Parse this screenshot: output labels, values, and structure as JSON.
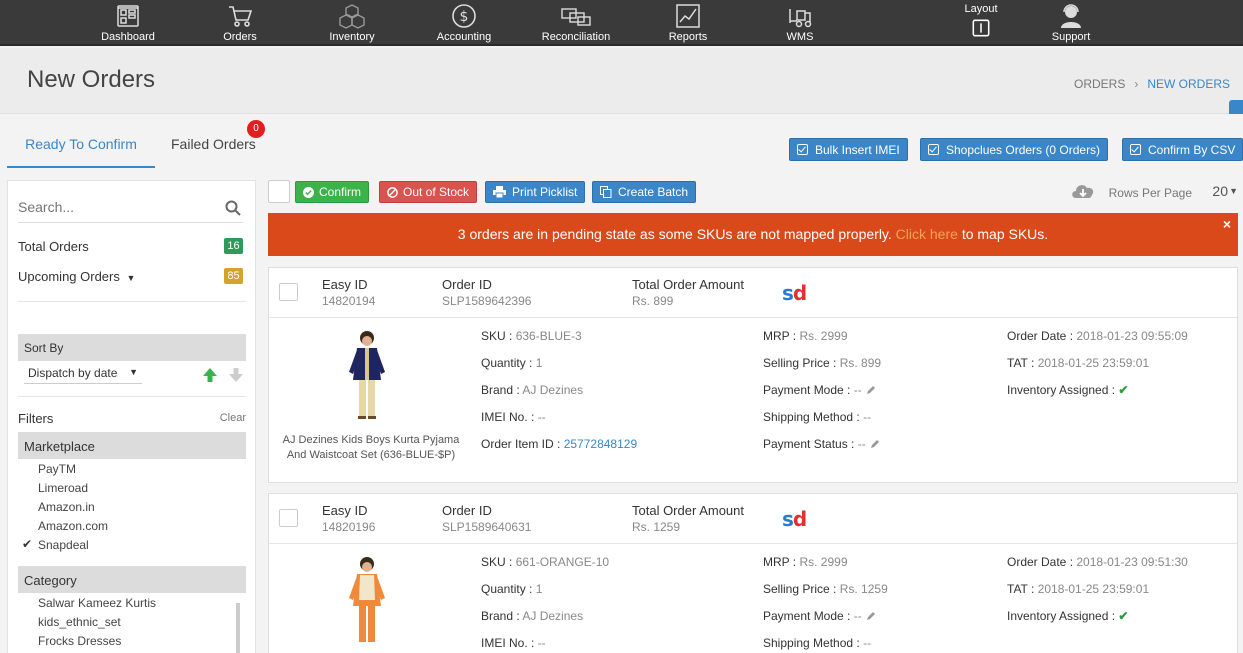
{
  "nav": {
    "items": [
      {
        "label": "Dashboard",
        "icon": "dashboard-icon"
      },
      {
        "label": "Orders",
        "icon": "cart-icon"
      },
      {
        "label": "Inventory",
        "icon": "cubes-icon"
      },
      {
        "label": "Accounting",
        "icon": "dollar-icon"
      },
      {
        "label": "Reconciliation",
        "icon": "reconciliation-icon"
      },
      {
        "label": "Reports",
        "icon": "chart-icon"
      },
      {
        "label": "WMS",
        "icon": "forklift-icon"
      },
      {
        "label": "Layout",
        "icon": "layout-icon"
      },
      {
        "label": "Support",
        "icon": "support-agent-icon"
      }
    ]
  },
  "header": {
    "title": "New Orders",
    "breadcrumb": [
      "ORDERS",
      "NEW ORDERS"
    ],
    "breadcrumb_sep": "›"
  },
  "tabs": {
    "ready": "Ready To Confirm",
    "failed": "Failed Orders",
    "failed_count": "0"
  },
  "toolbar": {
    "bulk_imei": "Bulk Insert IMEI",
    "shopclues": "Shopclues Orders (0 Orders)",
    "confirm_csv": "Confirm By CSV"
  },
  "sidebar": {
    "search_placeholder": "Search...",
    "total_orders_label": "Total Orders",
    "total_orders_count": "16",
    "upcoming_orders_label": "Upcoming Orders",
    "upcoming_orders_count": "85",
    "sort_by": "Sort By",
    "sort_value": "Dispatch by date",
    "filters": "Filters",
    "clear": "Clear",
    "marketplace": "Marketplace",
    "marketplace_items": [
      {
        "label": "PayTM",
        "checked": false
      },
      {
        "label": "Limeroad",
        "checked": false
      },
      {
        "label": "Amazon.in",
        "checked": false
      },
      {
        "label": "Amazon.com",
        "checked": false
      },
      {
        "label": "Snapdeal",
        "checked": true
      }
    ],
    "category": "Category",
    "category_items": [
      "Salwar Kameez Kurtis",
      "kids_ethnic_set",
      "Frocks Dresses"
    ]
  },
  "actions": {
    "confirm": "Confirm",
    "out_of_stock": "Out of Stock",
    "print_picklist": "Print Picklist",
    "create_batch": "Create Batch",
    "rows_per_page_label": "Rows Per Page",
    "rows_per_page_value": "20"
  },
  "alert": {
    "before": "3 orders are in pending state as some SKUs are not mapped properly.",
    "link": "Click here",
    "after": "to map SKUs.",
    "close": "×"
  },
  "labels": {
    "easy_id": "Easy ID",
    "order_id": "Order ID",
    "total_amount": "Total Order Amount",
    "sku": "SKU :",
    "quantity": "Quantity :",
    "brand": "Brand :",
    "imei": "IMEI No. :",
    "order_item_id": "Order Item ID :",
    "mrp": "MRP :",
    "selling_price": "Selling Price :",
    "payment_mode": "Payment Mode :",
    "shipping_method": "Shipping Method :",
    "payment_status": "Payment Status :",
    "order_date": "Order Date :",
    "tat": "TAT :",
    "inventory_assigned": "Inventory Assigned :"
  },
  "orders": [
    {
      "easy_id": "14820194",
      "order_id": "SLP1589642396",
      "total": "Rs. 899",
      "marketplace_logo": "sd",
      "product_name": "AJ Dezines Kids Boys Kurta Pyjama And Waistcoat Set (636-BLUE-$P)",
      "sku": "636-BLUE-3",
      "quantity": "1",
      "brand": "AJ Dezines",
      "imei": "--",
      "order_item_id": "25772848129",
      "mrp": "Rs. 2999",
      "selling_price": "Rs. 899",
      "payment_mode": "--",
      "shipping_method": "--",
      "payment_status": "--",
      "order_date": "2018-01-23 09:55:09",
      "tat": "2018-01-25 23:59:01",
      "inventory_assigned": "✔"
    },
    {
      "easy_id": "14820196",
      "order_id": "SLP1589640631",
      "total": "Rs. 1259",
      "marketplace_logo": "sd",
      "sku": "661-ORANGE-10",
      "quantity": "1",
      "brand": "AJ Dezines",
      "imei": "--",
      "mrp": "Rs. 2999",
      "selling_price": "Rs. 1259",
      "payment_mode": "--",
      "shipping_method": "--",
      "order_date": "2018-01-23 09:51:30",
      "tat": "2018-01-25 23:59:01",
      "inventory_assigned": "✔"
    }
  ],
  "colors": {
    "accent": "#3a86c8",
    "confirm": "#3cb34a",
    "out_of_stock": "#d9534f",
    "alert": "#d9491a",
    "total_badge": "#2e9a5c",
    "upcoming_badge": "#d4a32c"
  }
}
